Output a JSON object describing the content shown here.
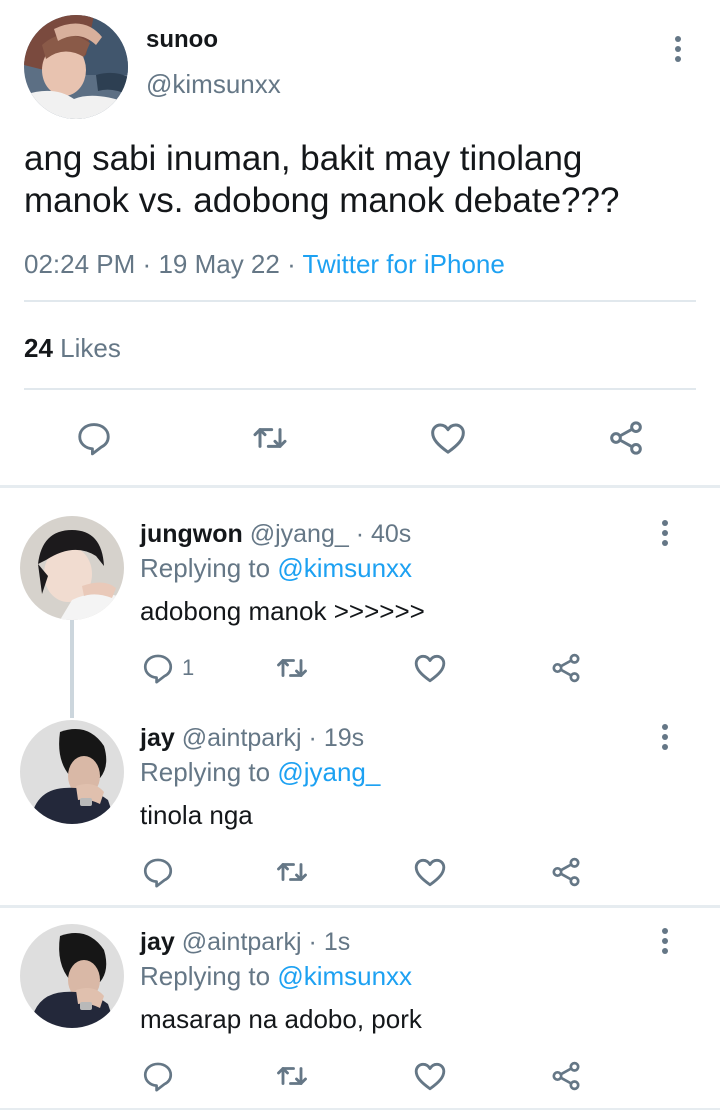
{
  "main_tweet": {
    "display_name": "sunoo",
    "handle": "@kimsunxx",
    "text_line1": "ang sabi inuman, bakit may tinolang",
    "text_line2": "manok vs. adobong manok debate???",
    "time": "02:24 PM",
    "dot1": "·",
    "date": "19 May 22",
    "dot2": "·",
    "source": "Twitter for iPhone",
    "likes_count": "24",
    "likes_label": "Likes",
    "icons": [
      "reply-icon",
      "retweet-icon",
      "like-icon",
      "share-icon"
    ]
  },
  "replies": [
    {
      "display_name": "jungwon",
      "handle": "@jyang_",
      "time": "· 40s",
      "replying_prefix": "Replying to",
      "replying_to": "@kimsunxx",
      "text": "adobong manok >>>>>>",
      "reply_count": "1"
    },
    {
      "display_name": "jay",
      "handle": "@aintparkj",
      "time": "· 19s",
      "replying_prefix": "Replying to",
      "replying_to": "@jyang_",
      "text": "tinola nga",
      "reply_count": ""
    },
    {
      "display_name": "jay",
      "handle": "@aintparkj",
      "time": "· 1s",
      "replying_prefix": "Replying to",
      "replying_to": "@kimsunxx",
      "text": "masarap na adobo, pork",
      "reply_count": ""
    }
  ],
  "colors": {
    "link_blue": "#1da1f2",
    "secondary_gray": "#657786",
    "divider": "#e1e8ed"
  }
}
